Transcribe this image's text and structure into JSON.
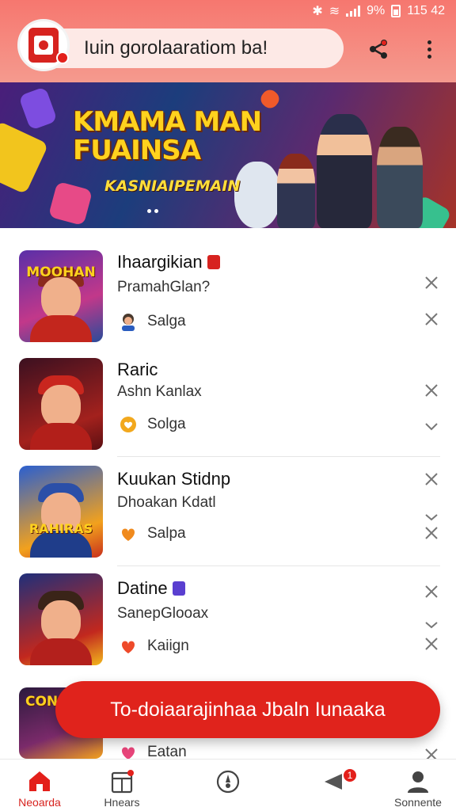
{
  "status_bar": {
    "battery": "9%",
    "time": "115 42"
  },
  "header": {
    "search_text": "Iuin gorolaaratiom ba!"
  },
  "banner": {
    "title_line1": "KMAMA MAN",
    "title_line2": "FUAINSA",
    "subtitle": "KASNIAIPEMAIN"
  },
  "games": [
    {
      "title": "Ihaargikian",
      "subtitle": "PramahGlan?",
      "meta": "Salga",
      "thumb_label": "MOOHAN",
      "tag_color": "#d7231f"
    },
    {
      "title": "Raric",
      "subtitle": "Ashn Kanlax",
      "meta": "Solga",
      "thumb_label": "",
      "tag_color": ""
    },
    {
      "title": "Kuukan Stidnp",
      "subtitle": "Dhoakan Kdatl",
      "meta": "Salpa",
      "thumb_label": "RAHIRAS",
      "tag_color": ""
    },
    {
      "title": "Datine",
      "subtitle": "SanepGlooax",
      "meta": "Kaiign",
      "thumb_label": "",
      "tag_color": "#5a3fd0"
    },
    {
      "title": "",
      "subtitle": "",
      "meta": "Eatan",
      "thumb_label": "CON",
      "tag_color": ""
    }
  ],
  "cta": {
    "label": "To-doiaarajinhaa Jbaln Iunaaka"
  },
  "nav": [
    {
      "label": "Neoarda",
      "icon": "home-icon",
      "active": true
    },
    {
      "label": "Hnears",
      "icon": "calendar-icon",
      "active": false
    },
    {
      "label": "",
      "icon": "compass-icon",
      "active": false
    },
    {
      "label": "",
      "icon": "send-icon",
      "active": false,
      "badge": "1"
    },
    {
      "label": "Sonnente",
      "icon": "profile-icon",
      "active": false
    }
  ],
  "colors": {
    "accent": "#e0231c",
    "header": "#f6776f"
  }
}
